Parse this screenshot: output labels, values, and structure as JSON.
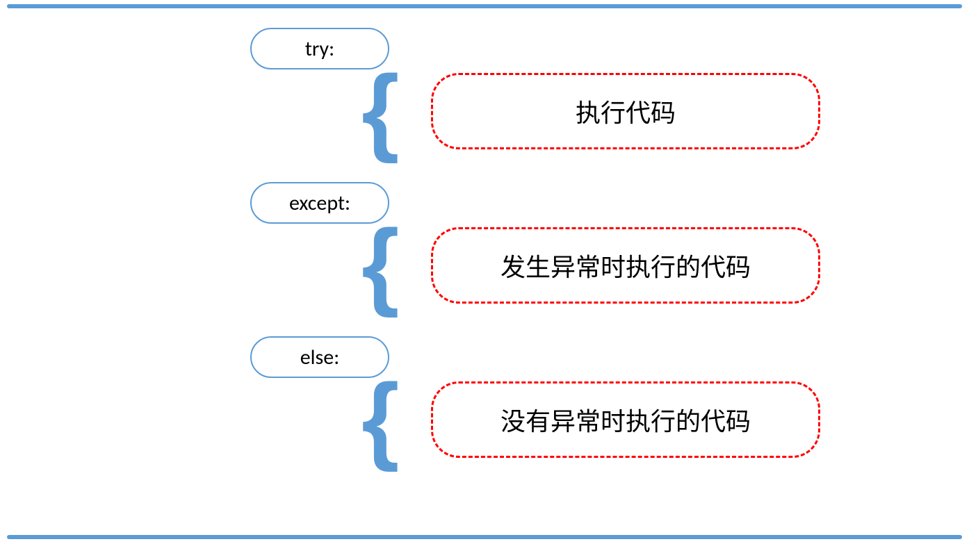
{
  "sections": {
    "try": {
      "label": "try:",
      "body": "执行代码"
    },
    "except": {
      "label": "except:",
      "body": "发生异常时执行的代码"
    },
    "else": {
      "label": "else:",
      "body": "没有异常时执行的代码"
    }
  },
  "brace_glyph": "{"
}
